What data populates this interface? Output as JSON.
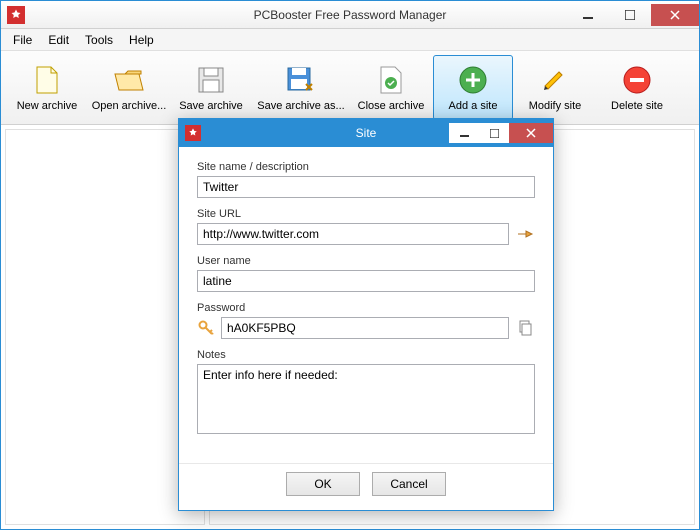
{
  "window": {
    "title": "PCBooster Free Password Manager"
  },
  "menu": {
    "items": [
      "File",
      "Edit",
      "Tools",
      "Help"
    ]
  },
  "toolbar": {
    "new_archive": "New archive",
    "open_archive": "Open archive...",
    "save_archive": "Save archive",
    "save_archive_as": "Save archive as...",
    "close_archive": "Close archive",
    "add_site": "Add a site",
    "modify_site": "Modify site",
    "delete_site": "Delete site"
  },
  "dialog": {
    "title": "Site",
    "labels": {
      "site_name": "Site name / description",
      "site_url": "Site URL",
      "user_name": "User name",
      "password": "Password",
      "notes": "Notes"
    },
    "values": {
      "site_name": "Twitter",
      "site_url": "http://www.twitter.com",
      "user_name": "latine",
      "password": "hA0KF5PBQ",
      "notes": "Enter info here if needed:"
    },
    "buttons": {
      "ok": "OK",
      "cancel": "Cancel"
    }
  }
}
